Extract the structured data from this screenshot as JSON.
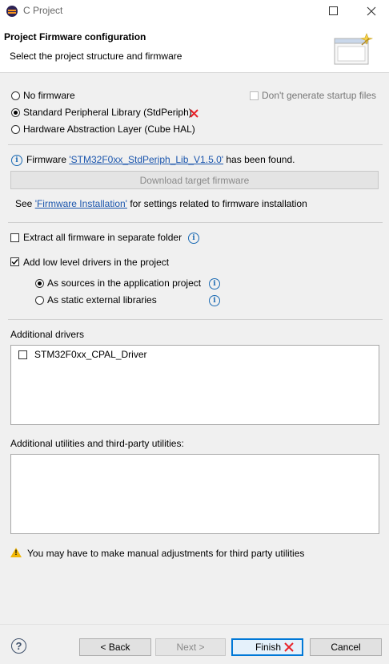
{
  "window": {
    "title": "C Project"
  },
  "header": {
    "title": "Project Firmware configuration",
    "subtitle": "Select the project structure and firmware"
  },
  "firmware_options": {
    "no_firmware": "No firmware",
    "stdperiph": "Standard Peripheral Library (StdPeriph)",
    "cube_hal": "Hardware Abstraction Layer (Cube HAL)",
    "selected": "stdperiph",
    "dont_generate_startup": "Don't generate startup files"
  },
  "firmware_info": {
    "prefix": "Firmware ",
    "firmware_name": "'STM32F0xx_StdPeriph_Lib_V1.5.0'",
    "suffix": " has been found.",
    "download_button": "Download target firmware",
    "see_prefix": "See ",
    "install_link": "'Firmware Installation'",
    "see_suffix": " for settings related to firmware installation"
  },
  "options": {
    "extract_all": "Extract all firmware in separate folder",
    "extract_all_checked": false,
    "add_low_level": "Add low level drivers in the project",
    "add_low_level_checked": true,
    "as_sources": "As sources in the application project",
    "as_static": "As static external libraries",
    "driver_mode_selected": "as_sources"
  },
  "additional_drivers": {
    "label": "Additional drivers",
    "items": [
      {
        "label": "STM32F0xx_CPAL_Driver",
        "checked": false
      }
    ]
  },
  "utilities": {
    "label": "Additional utilities and third-party utilities:",
    "items": []
  },
  "warning": {
    "text": "You may have to make manual adjustments for third party utilities"
  },
  "buttons": {
    "back": "< Back",
    "next": "Next >",
    "finish": "Finish",
    "cancel": "Cancel"
  },
  "colors": {
    "link": "#1a55ad",
    "info": "#1b6ab3",
    "annotation_mark": "#e8232a",
    "default_button": "#0078d7"
  }
}
